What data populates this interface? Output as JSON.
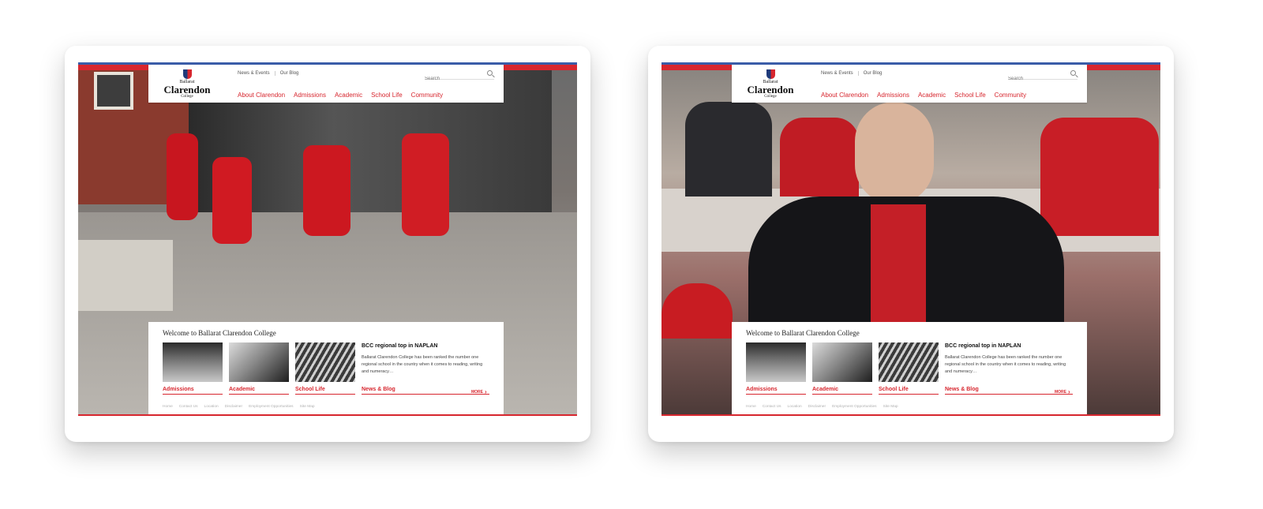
{
  "screens": [
    {
      "id": "left",
      "header": {
        "logo": {
          "top": "Ballarat",
          "main": "Clarendon",
          "bottom": "College"
        },
        "utility_nav": [
          "News & Events",
          "Our Blog"
        ],
        "search_placeholder": "Search",
        "main_nav": [
          "About Clarendon",
          "Admissions",
          "Academic",
          "School Life",
          "Community"
        ]
      },
      "welcome": {
        "title": "Welcome to Ballarat Clarendon College",
        "cards": [
          "Admissions",
          "Academic",
          "School Life"
        ],
        "news": {
          "title": "BCC regional top in NAPLAN",
          "text": "Ballarat Clarendon College has been ranked the number one regional school in the country when it comes to reading, writing and numeracy…",
          "label": "News & Blog",
          "more": "MORE"
        }
      },
      "footer_links": [
        "Home",
        "Contact Us",
        "Location",
        "Disclaimer",
        "Employment Opportunities",
        "Site Map"
      ]
    },
    {
      "id": "right",
      "header": {
        "logo": {
          "top": "Ballarat",
          "main": "Clarendon",
          "bottom": "College"
        },
        "utility_nav": [
          "News & Events",
          "Our Blog"
        ],
        "search_placeholder": "Search",
        "main_nav": [
          "About Clarendon",
          "Admissions",
          "Academic",
          "School Life",
          "Community"
        ]
      },
      "welcome": {
        "title": "Welcome to Ballarat Clarendon College",
        "cards": [
          "Admissions",
          "Academic",
          "School Life"
        ],
        "news": {
          "title": "BCC regional top in NAPLAN",
          "text": "Ballarat Clarendon College has been ranked the number one regional school in the country when it comes to reading, writing and numeracy…",
          "label": "News & Blog",
          "more": "MORE"
        }
      },
      "footer_links": [
        "Home",
        "Contact Us",
        "Location",
        "Disclaimer",
        "Employment Opportunities",
        "Site Map"
      ]
    }
  ],
  "colors": {
    "brand_red": "#d7262e",
    "brand_blue": "#3a5ca8"
  }
}
